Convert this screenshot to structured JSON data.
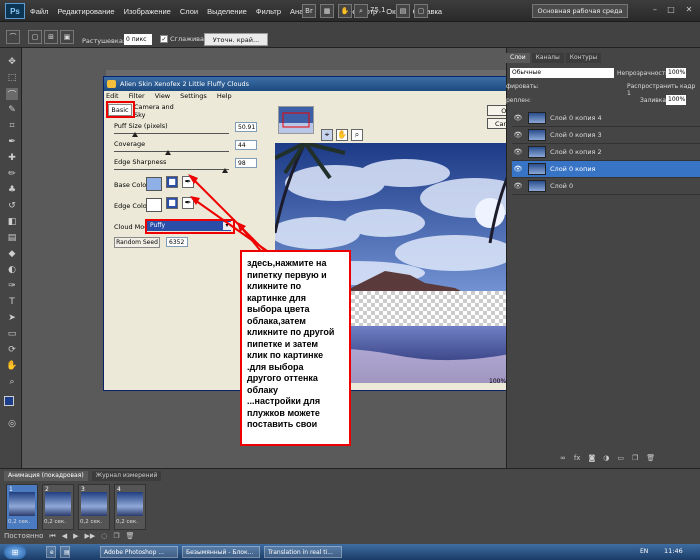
{
  "app": {
    "logo": "Ps",
    "menu": [
      "Файл",
      "Редактирование",
      "Изображение",
      "Слои",
      "Выделение",
      "Фильтр",
      "Анализ",
      "3D",
      "Просмотр",
      "Окно",
      "Справка"
    ],
    "zoom": "75,1",
    "workspace": "Основная рабочая среда",
    "window_buttons": [
      "–",
      "□",
      "✕"
    ]
  },
  "options": {
    "feather_label": "Растушевка:",
    "feather_value": "0 пикс",
    "antialias_label": "Сглаживание",
    "antialias_check": "✓",
    "refine_label": "Уточн. край..."
  },
  "dialog": {
    "title": "Alien Skin Xenofex 2 Little Fluffy Clouds",
    "menu": [
      "Edit",
      "Filter",
      "View",
      "Settings",
      "Help"
    ],
    "tabs": [
      "Basic",
      "Camera and Sky"
    ],
    "puff_label": "Puff Size (pixels)",
    "puff_value": "50.91",
    "coverage_label": "Coverage",
    "coverage_value": "44",
    "edge_sharp_label": "Edge Sharpness",
    "edge_sharp_value": "98",
    "base_color_label": "Base Color",
    "edge_color_label": "Edge Color",
    "cloud_model_label": "Cloud Model",
    "cloud_model_value": "Puffy",
    "random_seed_label": "Random Seed",
    "random_seed_value": "6352",
    "ok_label": "OK",
    "cancel_label": "Cancel",
    "zoom_pct": "100%",
    "base_color": "#8fb0e6",
    "edge_color": "#ffffff"
  },
  "annotation": {
    "lines": [
      "здесь,нажмите на",
      "пипетку первую и",
      "кликните по",
      "картинке для",
      "выбора цвета",
      "облака,затем",
      "кликните по другой",
      "пипетке и затем",
      "клик  по картинке",
      ".для выбора",
      "другого оттенка",
      "облаку",
      "...настройки для",
      "плужков можете",
      "поставить свои"
    ]
  },
  "layers_panel": {
    "tabs": [
      "Слои",
      "Каналы",
      "Контуры"
    ],
    "blend_mode": "Обычные",
    "opacity_label": "Непрозрачность:",
    "opacity_value": "100%",
    "unify_label": "фировать:",
    "propagate_label": "Распространить кадр 1",
    "lock_label": "реплен:",
    "fill_label": "Заливка:",
    "fill_value": "100%",
    "layers": [
      "Слой 0 копия 4",
      "Слой 0 копия 3",
      "Слой 0 копия 2",
      "Слой 0 копия",
      "Слой 0"
    ],
    "selected_index": 3
  },
  "animation": {
    "tabs": [
      "Анимация (покадровая)",
      "Журнал измерений"
    ],
    "frames": [
      {
        "num": "1",
        "delay": "0,2 сек."
      },
      {
        "num": "2",
        "delay": "0,2 сек."
      },
      {
        "num": "3",
        "delay": "0,2 сек."
      },
      {
        "num": "4",
        "delay": "0,2 сек."
      }
    ],
    "loop": "Постоянно"
  },
  "taskbar": {
    "start": "⊞",
    "tasks": [
      "Adobe Photoshop ...",
      "Безымянный - Блок...",
      "Translation in real ti..."
    ],
    "lang": "EN",
    "clock": "11:46"
  },
  "colors": {
    "accent": "#3874c6",
    "highlight": "#e00000"
  }
}
